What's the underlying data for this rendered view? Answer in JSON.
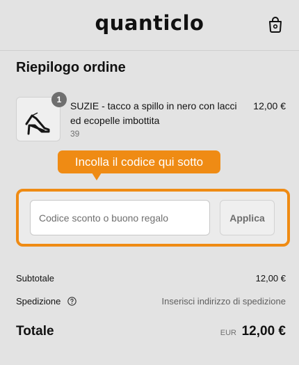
{
  "header": {
    "logo_text": "quanticlo",
    "cart_icon": "shopping-bag-icon"
  },
  "summary": {
    "title": "Riepilogo ordine",
    "item": {
      "quantity": "1",
      "name": "SUZIE - tacco a spillo in nero con lacci ed ecopelle imbottita",
      "variant": "39",
      "price": "12,00 €",
      "image_icon": "high-heel-shoe-image"
    }
  },
  "tooltip": {
    "text": "Incolla il codice qui sotto"
  },
  "discount": {
    "placeholder": "Codice sconto o buono regalo",
    "value": "",
    "apply_label": "Applica"
  },
  "totals": {
    "subtotal_label": "Subtotale",
    "subtotal_value": "12,00 €",
    "shipping_label": "Spedizione",
    "shipping_value": "Inserisci indirizzo di spedizione",
    "total_label": "Totale",
    "currency": "EUR",
    "total_value": "12,00 €"
  },
  "colors": {
    "accent": "#ef8b14",
    "background": "#e3e3e3"
  }
}
